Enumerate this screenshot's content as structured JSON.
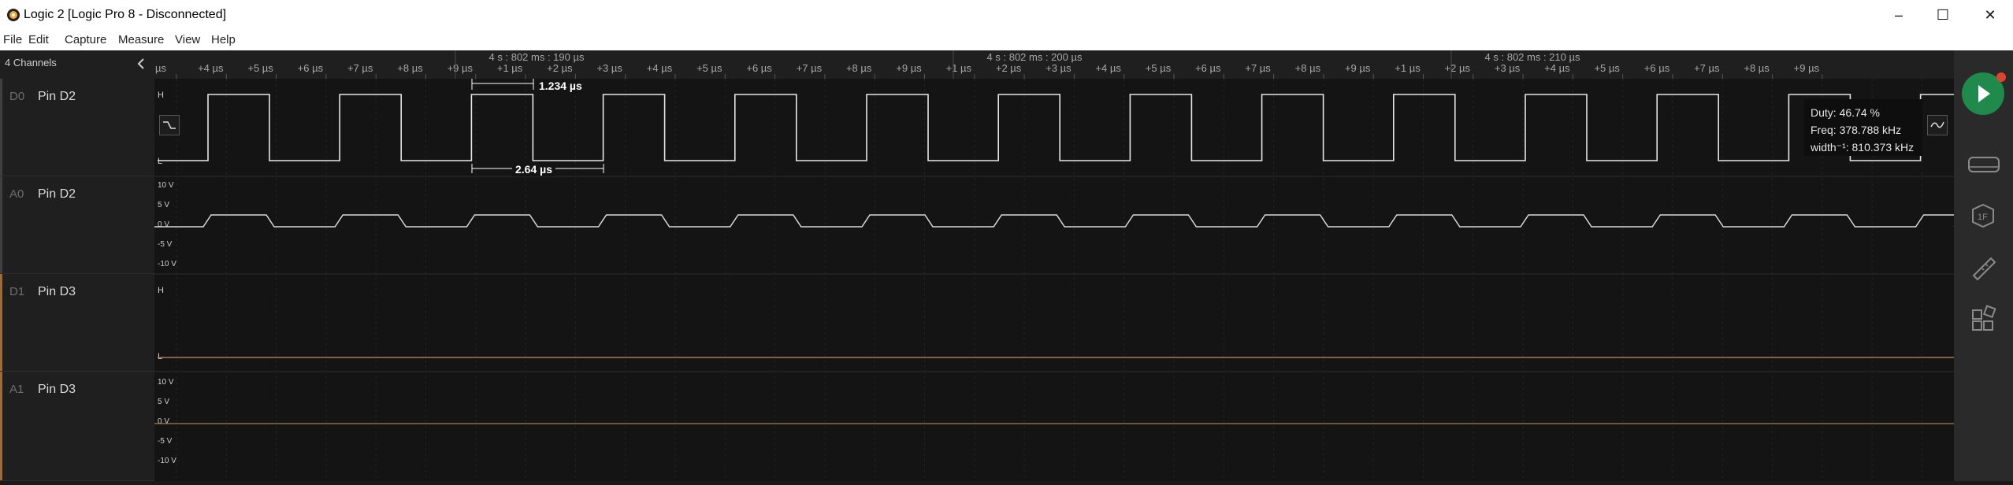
{
  "window": {
    "title": "Logic 2 [Logic Pro 8 - Disconnected]"
  },
  "menu": [
    "File",
    "Edit",
    "Capture",
    "Measure",
    "View",
    "Help"
  ],
  "sidebar": {
    "header": "4 Channels",
    "channels": [
      {
        "id": "D0",
        "name": "Pin D2",
        "accent": "#404040"
      },
      {
        "id": "A0",
        "name": "Pin D2",
        "accent": "#404040"
      },
      {
        "id": "D1",
        "name": "Pin D3",
        "accent": "#a06a3a"
      },
      {
        "id": "A1",
        "name": "Pin D3",
        "accent": "#a06a3a"
      }
    ]
  },
  "time_axis": {
    "group_labels": [
      "4 s : 802 ms : 190 µs",
      "4 s : 802 ms : 200 µs",
      "4 s : 802 ms : 210 µs"
    ],
    "ticks": [
      "µs",
      "+4 µs",
      "+5 µs",
      "+6 µs",
      "+7 µs",
      "+8 µs",
      "+9 µs",
      "+1 µs",
      "+2 µs",
      "+3 µs",
      "+4 µs",
      "+5 µs",
      "+6 µs",
      "+7 µs",
      "+8 µs",
      "+9 µs",
      "+1 µs",
      "+2 µs",
      "+3 µs",
      "+4 µs",
      "+5 µs",
      "+6 µs",
      "+7 µs",
      "+8 µs",
      "+9 µs",
      "+1 µs",
      "+2 µs",
      "+3 µs",
      "+4 µs",
      "+5 µs",
      "+6 µs",
      "+7 µs",
      "+8 µs",
      "+9 µs"
    ]
  },
  "digital_levels": {
    "high": "H",
    "low": "L"
  },
  "analog_levels": [
    "10 V",
    "5 V",
    "0 V",
    "-5 V",
    "-10 V"
  ],
  "measurements": {
    "pulse_width": "1.234 µs",
    "period": "2.64 µs"
  },
  "tooltip": {
    "duty": "Duty: 46.74 %",
    "freq": "Freq: 378.788 kHz",
    "width": "width⁻¹: 810.373 kHz"
  },
  "colors": {
    "digital_signal": "#e6e6e6",
    "analog_signal": "#d9d9d9",
    "d1_signal": "#a87a4e",
    "play_button": "#1f8a4c",
    "record_dot": "#e0442f"
  },
  "right_bar_icons": [
    "play-icon",
    "device-icon",
    "analyzer-icon",
    "measure-icon",
    "extensions-icon"
  ]
}
